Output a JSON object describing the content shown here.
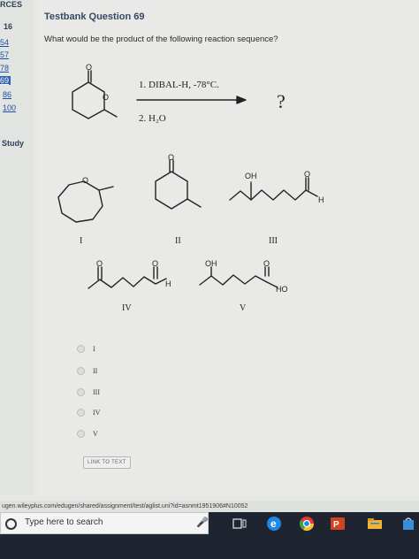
{
  "sidebar": {
    "header": "RCES",
    "items": [
      {
        "label": "16",
        "style": "bold"
      },
      {
        "label": "54",
        "style": "link"
      },
      {
        "label": "57",
        "style": "link"
      },
      {
        "label": "78",
        "style": "link"
      },
      {
        "label": "69",
        "style": "active"
      },
      {
        "label": "86",
        "style": "link"
      },
      {
        "label": "100",
        "style": "link"
      }
    ],
    "study_label": "Study"
  },
  "question": {
    "title": "Testbank Question 69",
    "prompt": "What would be the product of the following reaction sequence?"
  },
  "reaction": {
    "step1": "1. DIBAL-H, -78°C.",
    "step2": "2. H₂O",
    "unknown": "?"
  },
  "structures": {
    "atom_o": "O",
    "atom_oh": "OH",
    "atom_h": "H",
    "atom_ho": "HO",
    "labels": [
      "I",
      "II",
      "III",
      "IV",
      "V"
    ]
  },
  "choices": [
    "I",
    "II",
    "III",
    "IV",
    "V"
  ],
  "link_button": "LINK TO TEXT",
  "statusbar": {
    "url": "ugen.wileyplus.com/edugen/shared/assignment/test/aglist.uni?id=asnmt1951906#N10052"
  },
  "taskbar": {
    "search_placeholder": "Type here to search",
    "icon_colors": {
      "edge": "#1e88e5",
      "chrome": "#e53935",
      "powerpoint": "#d04423",
      "explorer": "#f2b233"
    }
  }
}
